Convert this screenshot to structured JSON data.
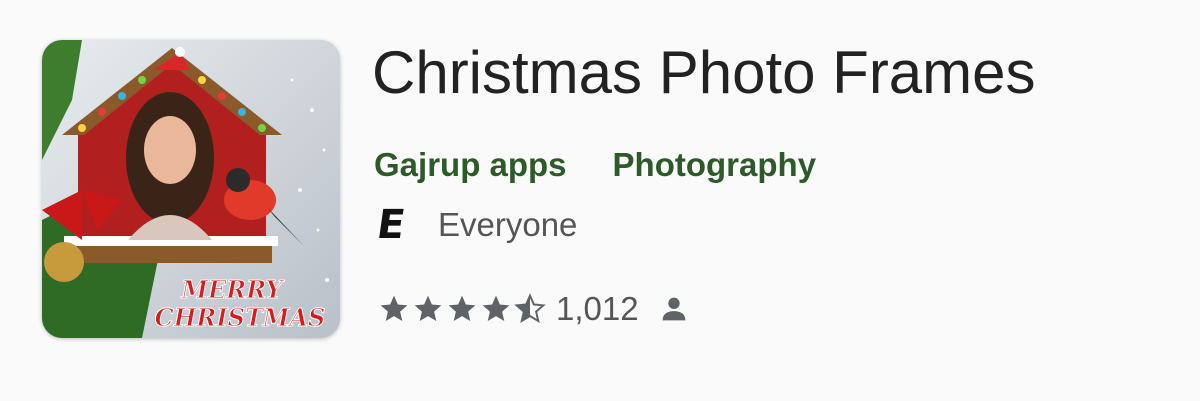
{
  "app": {
    "title": "Christmas Photo Frames",
    "developer": "Gajrup apps",
    "category": "Photography",
    "content_rating_badge": "E",
    "content_rating": "Everyone",
    "rating_stars": 4.5,
    "review_count": "1,012",
    "icon_text_line1": "MERRY",
    "icon_text_line2": "CHRISTMAS"
  },
  "colors": {
    "link_green": "#2e5a2a",
    "star_gray": "#5f6368",
    "title": "#222222"
  },
  "icons": {
    "star": "star-icon",
    "half_star": "half-star-icon",
    "person": "person-icon"
  }
}
